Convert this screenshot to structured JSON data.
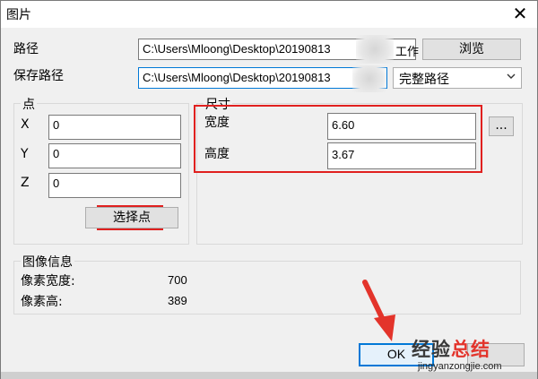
{
  "window": {
    "title": "图片",
    "close_glyph": "✕"
  },
  "path": {
    "label": "路径",
    "value": "C:\\Users\\Mloong\\Desktop\\20190813",
    "trailing_visible": "工作",
    "browse_label": "浏览"
  },
  "save_path": {
    "label": "保存路径",
    "value": "C:\\Users\\Mloong\\Desktop\\20190813",
    "dropdown_selected": "完整路径"
  },
  "point": {
    "group_label": "点",
    "x_label": "X",
    "x_value": "0",
    "y_label": "Y",
    "y_value": "0",
    "z_label": "Z",
    "z_value": "0",
    "pick_button": "选择点"
  },
  "size": {
    "group_label": "尺寸",
    "width_label": "宽度",
    "width_value": "6.60",
    "height_label": "高度",
    "height_value": "3.67",
    "more_button": "..."
  },
  "image_info": {
    "group_label": "图像信息",
    "pixel_width_label": "像素宽度:",
    "pixel_width_value": "700",
    "pixel_height_label": "像素高:",
    "pixel_height_value": "389"
  },
  "buttons": {
    "ok": "OK"
  },
  "watermark": {
    "brand_a": "经验",
    "brand_b": "总结",
    "url": "jingyanzongjie.com"
  },
  "colors": {
    "highlight_red": "#e0201f",
    "focus_blue": "#0078d7",
    "arrow_red": "#e3342b"
  }
}
